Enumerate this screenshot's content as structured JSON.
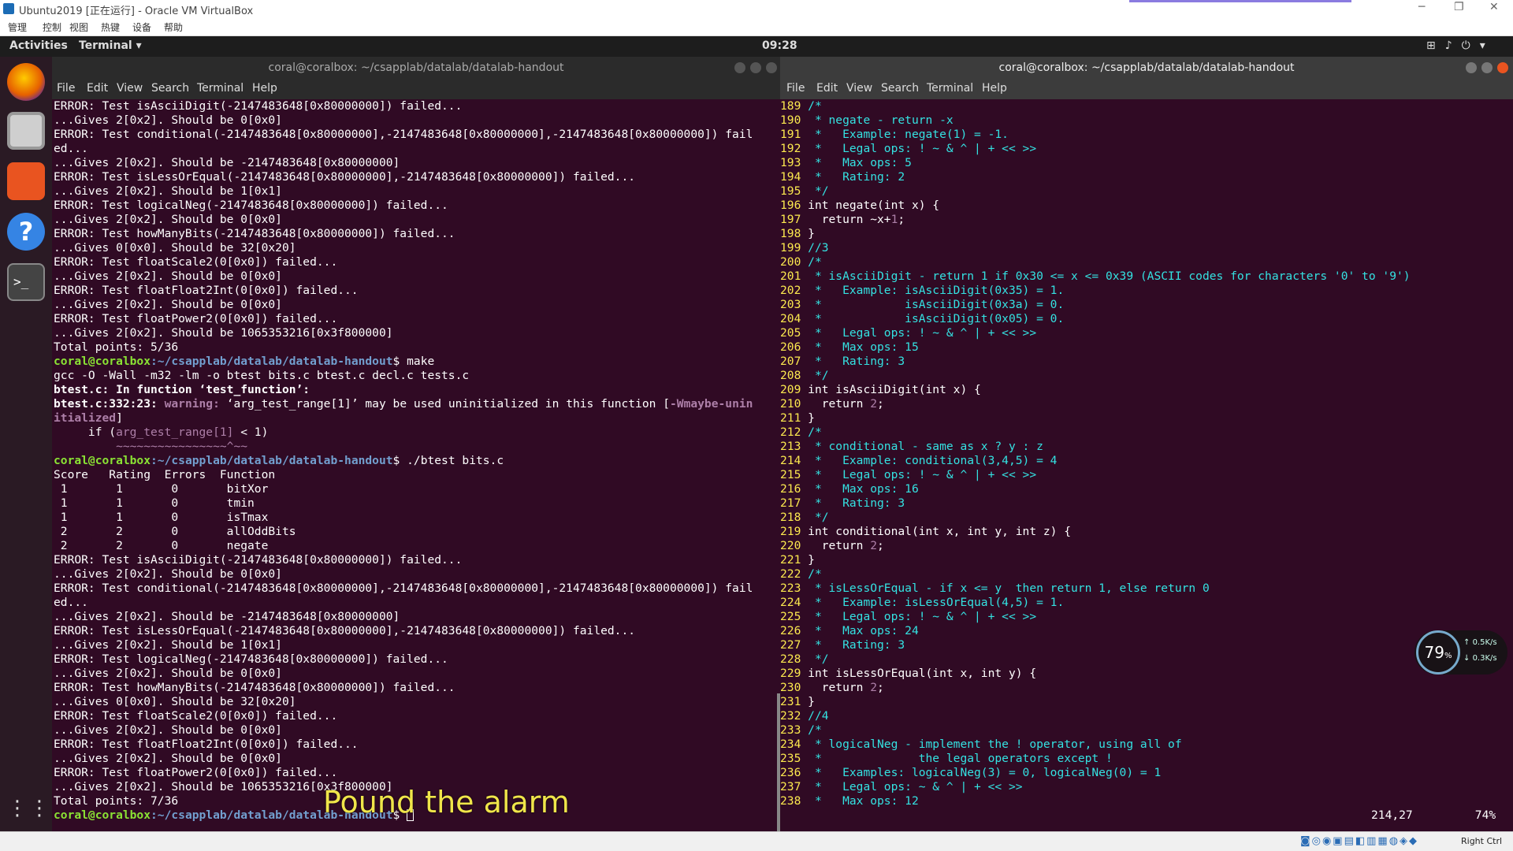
{
  "vbox": {
    "title": "Ubuntu2019 [正在运行] - Oracle VM VirtualBox",
    "menu": [
      "管理",
      "控制",
      "视图",
      "热键",
      "设备",
      "帮助"
    ],
    "host_key": "Right Ctrl"
  },
  "topbar": {
    "activities": "Activities",
    "app": "Terminal ▾",
    "clock": "09:28"
  },
  "win1": {
    "title": "coral@coralbox: ~/csapplab/datalab/datalab-handout",
    "menu": [
      "File",
      "Edit",
      "View",
      "Search",
      "Terminal",
      "Help"
    ]
  },
  "win2": {
    "title": "coral@coralbox: ~/csapplab/datalab/datalab-handout",
    "menu": [
      "File",
      "Edit",
      "View",
      "Search",
      "Terminal",
      "Help"
    ]
  },
  "left_lines": [
    {
      "k": "plain",
      "t": "ERROR: Test isAsciiDigit(-2147483648[0x80000000]) failed..."
    },
    {
      "k": "plain",
      "t": "...Gives 2[0x2]. Should be 0[0x0]"
    },
    {
      "k": "plain",
      "t": "ERROR: Test conditional(-2147483648[0x80000000],-2147483648[0x80000000],-2147483648[0x80000000]) fail"
    },
    {
      "k": "plain",
      "t": "ed..."
    },
    {
      "k": "plain",
      "t": "...Gives 2[0x2]. Should be -2147483648[0x80000000]"
    },
    {
      "k": "plain",
      "t": "ERROR: Test isLessOrEqual(-2147483648[0x80000000],-2147483648[0x80000000]) failed..."
    },
    {
      "k": "plain",
      "t": "...Gives 2[0x2]. Should be 1[0x1]"
    },
    {
      "k": "plain",
      "t": "ERROR: Test logicalNeg(-2147483648[0x80000000]) failed..."
    },
    {
      "k": "plain",
      "t": "...Gives 2[0x2]. Should be 0[0x0]"
    },
    {
      "k": "plain",
      "t": "ERROR: Test howManyBits(-2147483648[0x80000000]) failed..."
    },
    {
      "k": "plain",
      "t": "...Gives 0[0x0]. Should be 32[0x20]"
    },
    {
      "k": "plain",
      "t": "ERROR: Test floatScale2(0[0x0]) failed..."
    },
    {
      "k": "plain",
      "t": "...Gives 2[0x2]. Should be 0[0x0]"
    },
    {
      "k": "plain",
      "t": "ERROR: Test floatFloat2Int(0[0x0]) failed..."
    },
    {
      "k": "plain",
      "t": "...Gives 2[0x2]. Should be 0[0x0]"
    },
    {
      "k": "plain",
      "t": "ERROR: Test floatPower2(0[0x0]) failed..."
    },
    {
      "k": "plain",
      "t": "...Gives 2[0x2]. Should be 1065353216[0x3f800000]"
    },
    {
      "k": "plain",
      "t": "Total points: 5/36"
    },
    {
      "k": "prompt",
      "u": "coral@coralbox",
      "p": ":~/csapplab/datalab/datalab-handout",
      "c": "$ make"
    },
    {
      "k": "plain",
      "t": "gcc -O -Wall -m32 -lm -o btest bits.c btest.c decl.c tests.c"
    },
    {
      "k": "bold",
      "t": "btest.c: In function ‘test_function’:"
    },
    {
      "k": "warn",
      "a": "btest.c:332:23: ",
      "b": "warning: ",
      "c": "‘arg_test_range[1]’ may be used uninitialized in this function [",
      "d": "-Wmaybe-unin"
    },
    {
      "k": "warn2",
      "t": "itialized",
      "e": "]"
    },
    {
      "k": "code",
      "a": "     if (",
      "b": "arg_test_range[1]",
      "c": " < 1)"
    },
    {
      "k": "tilde",
      "t": "         ~~~~~~~~~~~~~~~~^~~"
    },
    {
      "k": "prompt",
      "u": "coral@coralbox",
      "p": ":~/csapplab/datalab/datalab-handout",
      "c": "$ ./btest bits.c"
    },
    {
      "k": "plain",
      "t": "Score   Rating  Errors  Function"
    },
    {
      "k": "plain",
      "t": " 1       1       0       bitXor"
    },
    {
      "k": "plain",
      "t": " 1       1       0       tmin"
    },
    {
      "k": "plain",
      "t": " 1       1       0       isTmax"
    },
    {
      "k": "plain",
      "t": " 2       2       0       allOddBits"
    },
    {
      "k": "plain",
      "t": " 2       2       0       negate"
    },
    {
      "k": "plain",
      "t": "ERROR: Test isAsciiDigit(-2147483648[0x80000000]) failed..."
    },
    {
      "k": "plain",
      "t": "...Gives 2[0x2]. Should be 0[0x0]"
    },
    {
      "k": "plain",
      "t": "ERROR: Test conditional(-2147483648[0x80000000],-2147483648[0x80000000],-2147483648[0x80000000]) fail"
    },
    {
      "k": "plain",
      "t": "ed..."
    },
    {
      "k": "plain",
      "t": "...Gives 2[0x2]. Should be -2147483648[0x80000000]"
    },
    {
      "k": "plain",
      "t": "ERROR: Test isLessOrEqual(-2147483648[0x80000000],-2147483648[0x80000000]) failed..."
    },
    {
      "k": "plain",
      "t": "...Gives 2[0x2]. Should be 1[0x1]"
    },
    {
      "k": "plain",
      "t": "ERROR: Test logicalNeg(-2147483648[0x80000000]) failed..."
    },
    {
      "k": "plain",
      "t": "...Gives 2[0x2]. Should be 0[0x0]"
    },
    {
      "k": "plain",
      "t": "ERROR: Test howManyBits(-2147483648[0x80000000]) failed..."
    },
    {
      "k": "plain",
      "t": "...Gives 0[0x0]. Should be 32[0x20]"
    },
    {
      "k": "plain",
      "t": "ERROR: Test floatScale2(0[0x0]) failed..."
    },
    {
      "k": "plain",
      "t": "...Gives 2[0x2]. Should be 0[0x0]"
    },
    {
      "k": "plain",
      "t": "ERROR: Test floatFloat2Int(0[0x0]) failed..."
    },
    {
      "k": "plain",
      "t": "...Gives 2[0x2]. Should be 0[0x0]"
    },
    {
      "k": "plain",
      "t": "ERROR: Test floatPower2(0[0x0]) failed..."
    },
    {
      "k": "plain",
      "t": "...Gives 2[0x2]. Should be 1065353216[0x3f800000]"
    },
    {
      "k": "plain",
      "t": "Total points: 7/36"
    },
    {
      "k": "prompt",
      "u": "coral@coralbox",
      "p": ":~/csapplab/datalab/datalab-handout",
      "c": "$ ",
      "cursor": true
    }
  ],
  "right_lines": [
    {
      "n": "189",
      "k": "cm",
      "t": "/*"
    },
    {
      "n": "190",
      "k": "cm",
      "t": " * negate - return -x"
    },
    {
      "n": "191",
      "k": "cm",
      "t": " *   Example: negate(1) = -1."
    },
    {
      "n": "192",
      "k": "cm",
      "t": " *   Legal ops: ! ~ & ^ | + << >>"
    },
    {
      "n": "193",
      "k": "cm",
      "t": " *   Max ops: 5"
    },
    {
      "n": "194",
      "k": "cm",
      "t": " *   Rating: 2"
    },
    {
      "n": "195",
      "k": "cm",
      "t": " */"
    },
    {
      "n": "196",
      "k": "code",
      "t": "int negate(int x) {"
    },
    {
      "n": "197",
      "k": "code",
      "t": "  return ~x+",
      "num": "1",
      ";": ";"
    },
    {
      "n": "198",
      "k": "code",
      "t": "}"
    },
    {
      "n": "199",
      "k": "cm",
      "t": "//3"
    },
    {
      "n": "200",
      "k": "cm",
      "t": "/*"
    },
    {
      "n": "201",
      "k": "cm",
      "t": " * isAsciiDigit - return 1 if 0x30 <= x <= 0x39 (ASCII codes for characters '0' to '9')"
    },
    {
      "n": "202",
      "k": "cm",
      "t": " *   Example: isAsciiDigit(0x35) = 1."
    },
    {
      "n": "203",
      "k": "cm",
      "t": " *            isAsciiDigit(0x3a) = 0."
    },
    {
      "n": "204",
      "k": "cm",
      "t": " *            isAsciiDigit(0x05) = 0."
    },
    {
      "n": "205",
      "k": "cm",
      "t": " *   Legal ops: ! ~ & ^ | + << >>"
    },
    {
      "n": "206",
      "k": "cm",
      "t": " *   Max ops: 15"
    },
    {
      "n": "207",
      "k": "cm",
      "t": " *   Rating: 3"
    },
    {
      "n": "208",
      "k": "cm",
      "t": " */"
    },
    {
      "n": "209",
      "k": "code",
      "t": "int isAsciiDigit(int x) {"
    },
    {
      "n": "210",
      "k": "code",
      "t": "  return ",
      "num": "2",
      ";": ";"
    },
    {
      "n": "211",
      "k": "code",
      "t": "}"
    },
    {
      "n": "212",
      "k": "cm",
      "t": "/*"
    },
    {
      "n": "213",
      "k": "cm",
      "t": " * conditional - same as x ? y : z"
    },
    {
      "n": "214",
      "k": "cm",
      "t": " *   Example: conditional(3,4,5) = 4"
    },
    {
      "n": "215",
      "k": "cm",
      "t": " *   Legal ops: ! ~ & ^ | + << >>"
    },
    {
      "n": "216",
      "k": "cm",
      "t": " *   Max ops: 16"
    },
    {
      "n": "217",
      "k": "cm",
      "t": " *   Rating: 3"
    },
    {
      "n": "218",
      "k": "cm",
      "t": " */"
    },
    {
      "n": "219",
      "k": "code",
      "t": "int conditional(int x, int y, int z) {"
    },
    {
      "n": "220",
      "k": "code",
      "t": "  return ",
      "num": "2",
      ";": ";"
    },
    {
      "n": "221",
      "k": "code",
      "t": "}"
    },
    {
      "n": "222",
      "k": "cm",
      "t": "/*"
    },
    {
      "n": "223",
      "k": "cm",
      "t": " * isLessOrEqual - if x <= y  then return 1, else return 0"
    },
    {
      "n": "224",
      "k": "cm",
      "t": " *   Example: isLessOrEqual(4,5) = 1."
    },
    {
      "n": "225",
      "k": "cm",
      "t": " *   Legal ops: ! ~ & ^ | + << >>"
    },
    {
      "n": "226",
      "k": "cm",
      "t": " *   Max ops: 24"
    },
    {
      "n": "227",
      "k": "cm",
      "t": " *   Rating: 3"
    },
    {
      "n": "228",
      "k": "cm",
      "t": " */"
    },
    {
      "n": "229",
      "k": "code",
      "t": "int isLessOrEqual(int x, int y) {"
    },
    {
      "n": "230",
      "k": "code",
      "t": "  return ",
      "num": "2",
      ";": ";"
    },
    {
      "n": "231",
      "k": "code",
      "t": "}"
    },
    {
      "n": "232",
      "k": "cm",
      "t": "//4"
    },
    {
      "n": "233",
      "k": "cm",
      "t": "/*"
    },
    {
      "n": "234",
      "k": "cm",
      "t": " * logicalNeg - implement the ! operator, using all of"
    },
    {
      "n": "235",
      "k": "cm",
      "t": " *              the legal operators except !"
    },
    {
      "n": "236",
      "k": "cm",
      "t": " *   Examples: logicalNeg(3) = 0, logicalNeg(0) = 1"
    },
    {
      "n": "237",
      "k": "cm",
      "t": " *   Legal ops: ~ & ^ | + << >>"
    },
    {
      "n": "238",
      "k": "cm",
      "t": " *   Max ops: 12"
    }
  ],
  "vim": {
    "pos": "214,27",
    "pct": "74%"
  },
  "subtitle": "Pound the alarm",
  "gauge": {
    "pct": "79",
    "unit": "%",
    "up": "0.5",
    "down": "0.3",
    "rate_unit": "K/s"
  }
}
